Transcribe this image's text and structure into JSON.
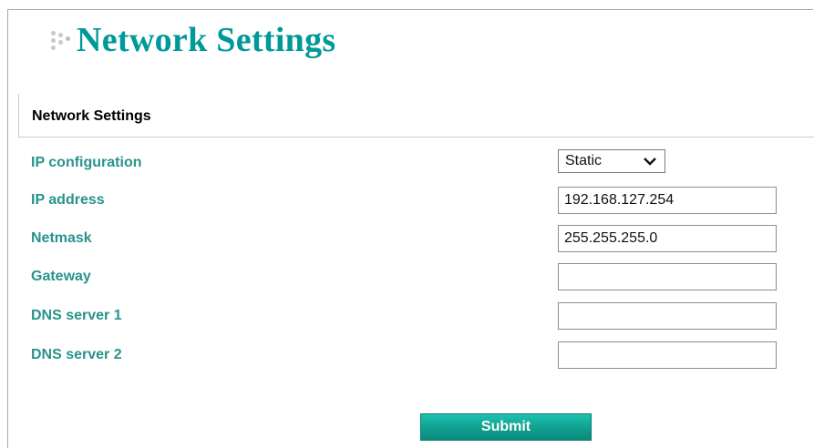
{
  "page": {
    "title": "Network Settings",
    "accent_color": "#009999",
    "label_color": "#28938c"
  },
  "section": {
    "title": "Network Settings"
  },
  "form": {
    "ip_configuration": {
      "label": "IP configuration",
      "value": "Static",
      "control": "select"
    },
    "ip_address": {
      "label": "IP address",
      "value": "192.168.127.254"
    },
    "netmask": {
      "label": "Netmask",
      "value": "255.255.255.0"
    },
    "gateway": {
      "label": "Gateway",
      "value": ""
    },
    "dns_server_1": {
      "label": "DNS server 1",
      "value": ""
    },
    "dns_server_2": {
      "label": "DNS server 2",
      "value": ""
    }
  },
  "actions": {
    "submit_label": "Submit"
  },
  "icons": {
    "title_icon": "dots-icon",
    "select_icon": "chevron-down-icon"
  }
}
